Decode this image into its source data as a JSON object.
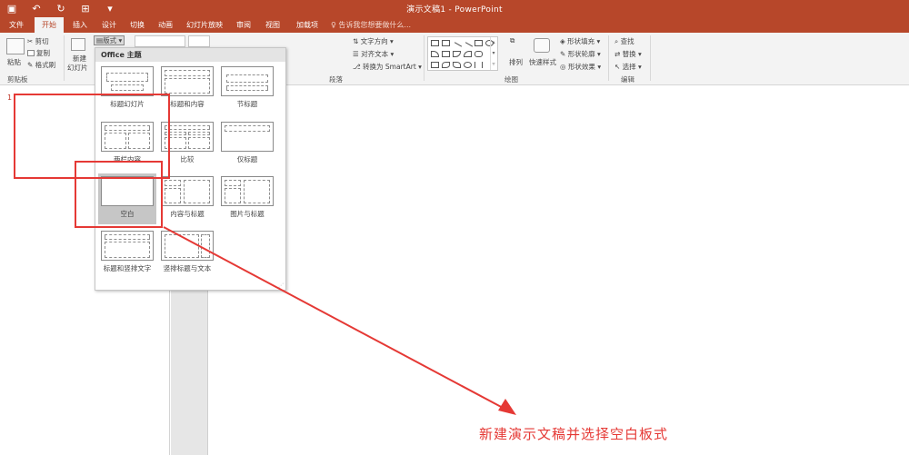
{
  "window": {
    "title": "演示文稿1 - PowerPoint",
    "qat": [
      "save-icon",
      "undo-icon",
      "redo-icon",
      "slideshow-icon",
      "customize-icon"
    ]
  },
  "tabs": [
    {
      "label": "文件"
    },
    {
      "label": "开始"
    },
    {
      "label": "插入"
    },
    {
      "label": "设计"
    },
    {
      "label": "切换"
    },
    {
      "label": "动画"
    },
    {
      "label": "幻灯片放映"
    },
    {
      "label": "审阅"
    },
    {
      "label": "视图"
    },
    {
      "label": "加载项"
    }
  ],
  "tell_me": "告诉我您想要做什么...",
  "ribbon": {
    "clipboard": {
      "paste": "粘贴",
      "cut": "剪切",
      "copy": "复制",
      "format_painter": "格式刷",
      "group": "剪贴板"
    },
    "slides": {
      "new_slide": "新建",
      "new_slide_2": "幻灯片",
      "layout": "版式"
    },
    "paragraph": {
      "text_direction": "文字方向",
      "align_text": "对齐文本",
      "smartart": "转换为 SmartArt",
      "group": "段落"
    },
    "drawing": {
      "arrange": "排列",
      "quick_styles": "快速样式",
      "shape_fill": "形状填充",
      "shape_outline": "形状轮廓",
      "shape_effects": "形状效果",
      "group": "绘图"
    },
    "editing": {
      "find": "查找",
      "replace": "替换",
      "select": "选择",
      "group": "编辑"
    }
  },
  "layout_dropdown": {
    "header": "Office 主题",
    "items": [
      {
        "label": "标题幻灯片"
      },
      {
        "label": "标题和内容"
      },
      {
        "label": "节标题"
      },
      {
        "label": "两栏内容"
      },
      {
        "label": "比较"
      },
      {
        "label": "仅标题"
      },
      {
        "label": "空白"
      },
      {
        "label": "内容与标题"
      },
      {
        "label": "图片与标题"
      },
      {
        "label": "标题和竖排文字"
      },
      {
        "label": "竖排标题与文本"
      }
    ],
    "selected": "空白"
  },
  "thumbnail_pane": {
    "slide_number": "1"
  },
  "annotation": {
    "text": "新建演示文稿并选择空白板式",
    "color": "#e53935"
  },
  "colors": {
    "accent": "#b7472a"
  }
}
